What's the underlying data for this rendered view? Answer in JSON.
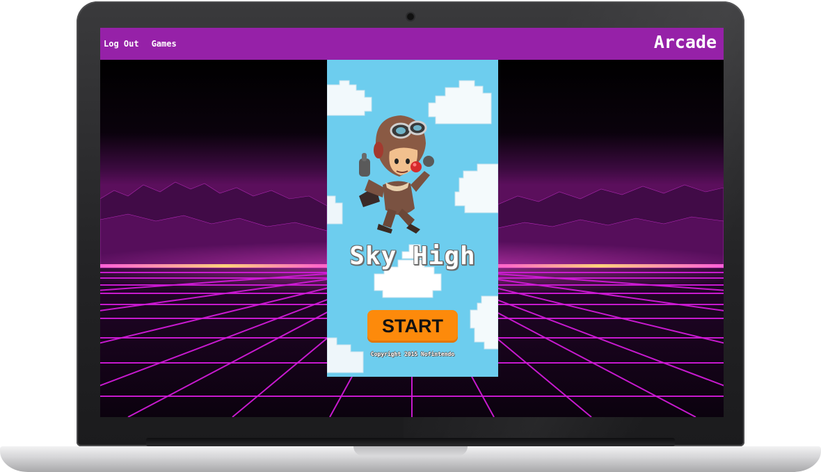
{
  "nav": {
    "links": [
      "Log Out",
      "Games"
    ],
    "brand": "Arcade"
  },
  "game": {
    "title": "Sky High",
    "start_label": "START",
    "copyright": "Copyright 2015 Nofintendo"
  },
  "colors": {
    "nav_bg": "#9621a8",
    "game_sky": "#6dcdee",
    "start_button": "#fd8a0b",
    "grid_magenta": "#d11bd8"
  },
  "icons": {
    "character": "aviator-character-illustration",
    "clouds": "pixel-cloud-icon"
  }
}
